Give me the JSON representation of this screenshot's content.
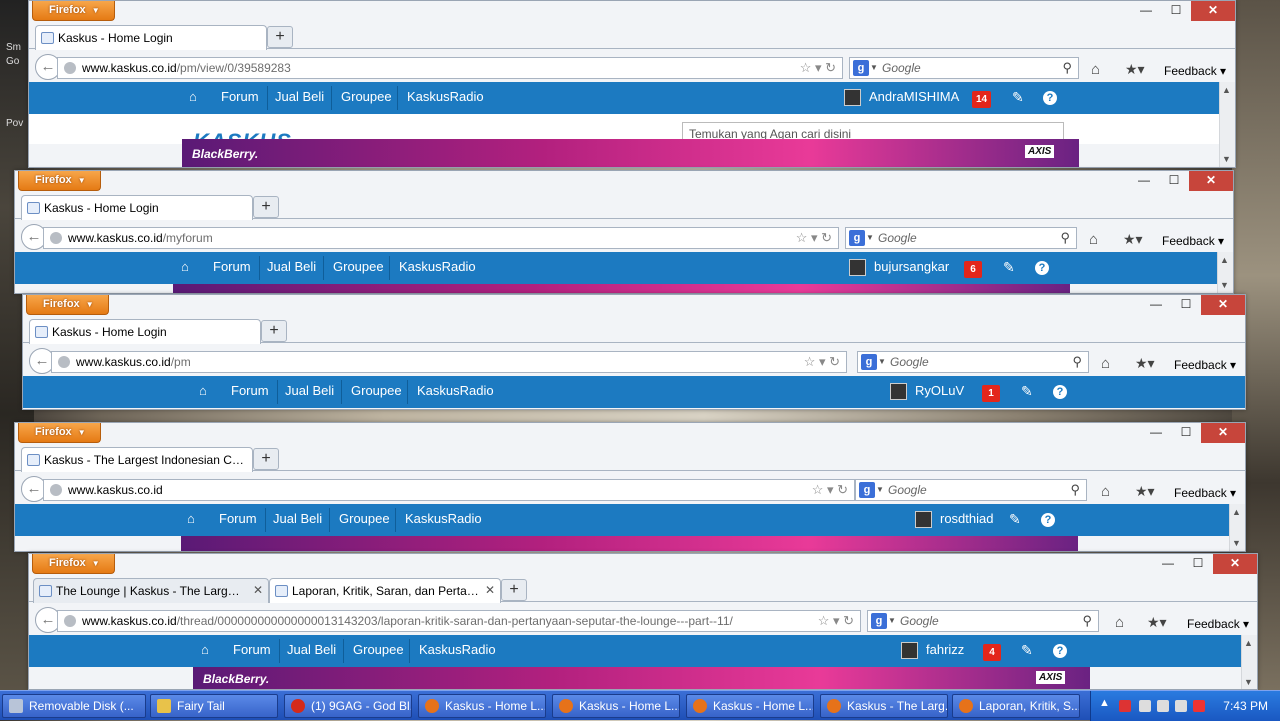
{
  "desktop": {
    "labels": [
      "Sm",
      "Go",
      "Pov"
    ]
  },
  "windows": [
    {
      "firefox_label": "Firefox",
      "tabs": [
        {
          "title": "Kaskus - Home Login"
        }
      ],
      "url_host": "www.kaskus.co.id",
      "url_path": "/pm/view/0/39589283",
      "search_placeholder": "Google",
      "feedback": "Feedback",
      "nav": [
        "Forum",
        "Jual Beli",
        "Groupee",
        "KaskusRadio"
      ],
      "username": "AndraMISHIMA",
      "badge": "14",
      "site_search_placeholder": "Temukan yang Agan cari disini",
      "banner_brand": "BlackBerry.",
      "banner_partner": "AXIS"
    },
    {
      "firefox_label": "Firefox",
      "tabs": [
        {
          "title": "Kaskus - Home Login"
        }
      ],
      "url_host": "www.kaskus.co.id",
      "url_path": "/myforum",
      "search_placeholder": "Google",
      "feedback": "Feedback",
      "nav": [
        "Forum",
        "Jual Beli",
        "Groupee",
        "KaskusRadio"
      ],
      "username": "bujursangkar",
      "badge": "6"
    },
    {
      "firefox_label": "Firefox",
      "tabs": [
        {
          "title": "Kaskus - Home Login"
        }
      ],
      "url_host": "www.kaskus.co.id",
      "url_path": "/pm",
      "search_placeholder": "Google",
      "feedback": "Feedback",
      "nav": [
        "Forum",
        "Jual Beli",
        "Groupee",
        "KaskusRadio"
      ],
      "username": "RyOLuV",
      "badge": "1"
    },
    {
      "firefox_label": "Firefox",
      "tabs": [
        {
          "title": "Kaskus - The Largest Indonesian Comm..."
        }
      ],
      "url_host": "www.kaskus.co.id",
      "url_path": "",
      "search_placeholder": "Google",
      "feedback": "Feedback",
      "nav": [
        "Forum",
        "Jual Beli",
        "Groupee",
        "KaskusRadio"
      ],
      "username": "rosdthiad",
      "badge": ""
    },
    {
      "firefox_label": "Firefox",
      "tabs": [
        {
          "title": "The Lounge | Kaskus - The Largest In..."
        },
        {
          "title": "Laporan, Kritik, Saran, dan Pertanyaa..."
        }
      ],
      "url_host": "www.kaskus.co.id",
      "url_path": "/thread/000000000000000013143203/laporan-kritik-saran-dan-pertanyaan-seputar-the-lounge---part--11/",
      "search_placeholder": "Google",
      "feedback": "Feedback",
      "nav": [
        "Forum",
        "Jual Beli",
        "Groupee",
        "KaskusRadio"
      ],
      "username": "fahrizz",
      "badge": "4",
      "banner_brand": "BlackBerry.",
      "banner_partner": "AXIS"
    }
  ],
  "taskbar": {
    "tasks": [
      {
        "label": "Removable Disk (...",
        "color": "#b8c4d8"
      },
      {
        "label": "Fairy Tail",
        "color": "#e8c24a"
      },
      {
        "label": "(1) 9GAG - God Bl...",
        "color": "#d42a1a"
      },
      {
        "label": "Kaskus - Home L...",
        "color": "#e6721a"
      },
      {
        "label": "Kaskus - Home L...",
        "color": "#e6721a"
      },
      {
        "label": "Kaskus - Home L...",
        "color": "#e6721a"
      },
      {
        "label": "Kaskus - The Larg...",
        "color": "#e6721a"
      },
      {
        "label": "Laporan, Kritik, S...",
        "color": "#e6721a"
      }
    ],
    "clock": "7:43 PM"
  }
}
